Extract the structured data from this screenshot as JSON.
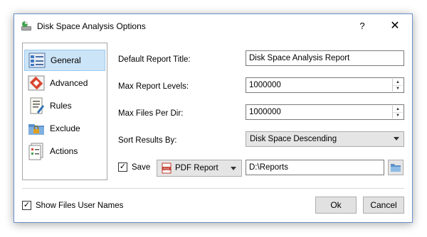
{
  "window": {
    "title": "Disk Space Analysis Options",
    "help_label": "?",
    "close_label": "✕"
  },
  "nav": {
    "items": [
      {
        "label": "General",
        "icon": "general-icon",
        "selected": true
      },
      {
        "label": "Advanced",
        "icon": "advanced-icon",
        "selected": false
      },
      {
        "label": "Rules",
        "icon": "rules-icon",
        "selected": false
      },
      {
        "label": "Exclude",
        "icon": "exclude-icon",
        "selected": false
      },
      {
        "label": "Actions",
        "icon": "actions-icon",
        "selected": false
      }
    ]
  },
  "form": {
    "report_title_label": "Default Report Title:",
    "report_title_value": "Disk Space Analysis Report",
    "max_levels_label": "Max Report Levels:",
    "max_levels_value": "1000000",
    "max_files_label": "Max Files Per Dir:",
    "max_files_value": "1000000",
    "sort_label": "Sort Results By:",
    "sort_value": "Disk Space Descending",
    "save_label": "Save",
    "save_checked": true,
    "save_format": "PDF Report",
    "save_path": "D:\\Reports"
  },
  "footer": {
    "show_user_names_label": "Show Files User Names",
    "show_user_names_checked": true,
    "ok_label": "Ok",
    "cancel_label": "Cancel"
  },
  "colors": {
    "selection_bg": "#cce4f7",
    "selection_border": "#99c9ef",
    "window_border": "#6a8fc8"
  }
}
